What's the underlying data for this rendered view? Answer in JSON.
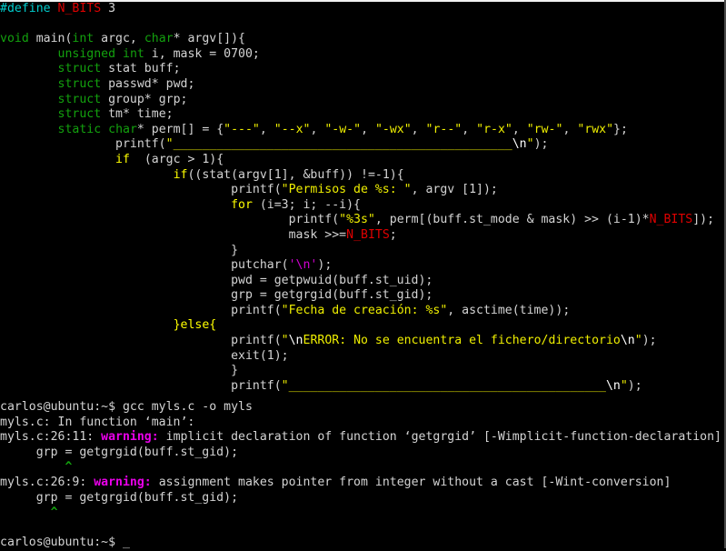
{
  "window": {
    "title": "myls.c — gcc compile session",
    "background_color": "#000000",
    "top_edge_color": "#f2f2f2",
    "right_edge_color": "#4a4a4a"
  },
  "palette": {
    "plain": "#d4d4d4",
    "keyword": "#13a10e",
    "preprocessor": "#00cdcd",
    "macro": "#e00000",
    "string": "#eeee00",
    "control": "#ffff00",
    "char_literal": "#d000d0",
    "escape": "#ffffff",
    "warning": "#ea00ea",
    "caret": "#13a10e"
  },
  "editor": {
    "language": "c",
    "filename": "myls.c",
    "lines": [
      [
        {
          "t": "#define ",
          "c": "c-preproc"
        },
        {
          "t": "N_BITS",
          "c": "c-macro"
        },
        {
          "t": " 3",
          "c": "c-plain"
        }
      ],
      [],
      [
        {
          "t": "void",
          "c": "c-keyword"
        },
        {
          "t": " main(",
          "c": "c-plain"
        },
        {
          "t": "int",
          "c": "c-keyword"
        },
        {
          "t": " argc, ",
          "c": "c-plain"
        },
        {
          "t": "char",
          "c": "c-keyword"
        },
        {
          "t": "* argv[]){",
          "c": "c-plain"
        }
      ],
      [
        {
          "t": "        ",
          "c": "c-plain"
        },
        {
          "t": "unsigned",
          "c": "c-keyword"
        },
        {
          "t": " ",
          "c": "c-plain"
        },
        {
          "t": "int",
          "c": "c-keyword"
        },
        {
          "t": " i, mask = 0700;",
          "c": "c-plain"
        }
      ],
      [
        {
          "t": "        ",
          "c": "c-plain"
        },
        {
          "t": "struct",
          "c": "c-keyword"
        },
        {
          "t": " stat buff;",
          "c": "c-plain"
        }
      ],
      [
        {
          "t": "        ",
          "c": "c-plain"
        },
        {
          "t": "struct",
          "c": "c-keyword"
        },
        {
          "t": " passwd* pwd;",
          "c": "c-plain"
        }
      ],
      [
        {
          "t": "        ",
          "c": "c-plain"
        },
        {
          "t": "struct",
          "c": "c-keyword"
        },
        {
          "t": " group* grp;",
          "c": "c-plain"
        }
      ],
      [
        {
          "t": "        ",
          "c": "c-plain"
        },
        {
          "t": "struct",
          "c": "c-keyword"
        },
        {
          "t": " tm* time;",
          "c": "c-plain"
        }
      ],
      [
        {
          "t": "        ",
          "c": "c-plain"
        },
        {
          "t": "static",
          "c": "c-keyword"
        },
        {
          "t": " ",
          "c": "c-plain"
        },
        {
          "t": "char",
          "c": "c-keyword"
        },
        {
          "t": "* perm[] = {",
          "c": "c-plain"
        },
        {
          "t": "\"---\"",
          "c": "c-string"
        },
        {
          "t": ", ",
          "c": "c-plain"
        },
        {
          "t": "\"--x\"",
          "c": "c-string"
        },
        {
          "t": ", ",
          "c": "c-plain"
        },
        {
          "t": "\"-w-\"",
          "c": "c-string"
        },
        {
          "t": ", ",
          "c": "c-plain"
        },
        {
          "t": "\"-wx\"",
          "c": "c-string"
        },
        {
          "t": ", ",
          "c": "c-plain"
        },
        {
          "t": "\"r--\"",
          "c": "c-string"
        },
        {
          "t": ", ",
          "c": "c-plain"
        },
        {
          "t": "\"r-x\"",
          "c": "c-string"
        },
        {
          "t": ", ",
          "c": "c-plain"
        },
        {
          "t": "\"rw-\"",
          "c": "c-string"
        },
        {
          "t": ", ",
          "c": "c-plain"
        },
        {
          "t": "\"rwx\"",
          "c": "c-string"
        },
        {
          "t": "};",
          "c": "c-plain"
        }
      ],
      [
        {
          "t": "                ",
          "c": "c-plain"
        },
        {
          "t": "printf(",
          "c": "c-plain"
        },
        {
          "t": "\"_______________________________________________",
          "c": "c-string"
        },
        {
          "t": "\\n",
          "c": "c-esc"
        },
        {
          "t": "\"",
          "c": "c-string"
        },
        {
          "t": ");",
          "c": "c-plain"
        }
      ],
      [
        {
          "t": "                ",
          "c": "c-plain"
        },
        {
          "t": "if",
          "c": "c-control"
        },
        {
          "t": "  (argc > 1){",
          "c": "c-plain"
        }
      ],
      [
        {
          "t": "                        ",
          "c": "c-plain"
        },
        {
          "t": "if",
          "c": "c-control"
        },
        {
          "t": "((stat(argv[1], &buff)) !=-1){",
          "c": "c-plain"
        }
      ],
      [
        {
          "t": "                                ",
          "c": "c-plain"
        },
        {
          "t": "printf(",
          "c": "c-plain"
        },
        {
          "t": "\"Permisos de %s: \"",
          "c": "c-string"
        },
        {
          "t": ", argv [1]);",
          "c": "c-plain"
        }
      ],
      [
        {
          "t": "                                ",
          "c": "c-plain"
        },
        {
          "t": "for",
          "c": "c-control"
        },
        {
          "t": " (i=3; i; --i){",
          "c": "c-plain"
        }
      ],
      [
        {
          "t": "                                        ",
          "c": "c-plain"
        },
        {
          "t": "printf(",
          "c": "c-plain"
        },
        {
          "t": "\"%3s\"",
          "c": "c-string"
        },
        {
          "t": ", perm[(buff.st_mode & mask) >> (i-1)*",
          "c": "c-plain"
        },
        {
          "t": "N_BITS",
          "c": "c-macro"
        },
        {
          "t": "]);",
          "c": "c-plain"
        }
      ],
      [
        {
          "t": "                                        ",
          "c": "c-plain"
        },
        {
          "t": "mask >>=",
          "c": "c-plain"
        },
        {
          "t": "N_BITS",
          "c": "c-macro"
        },
        {
          "t": ";",
          "c": "c-plain"
        }
      ],
      [
        {
          "t": "                                }",
          "c": "c-plain"
        }
      ],
      [
        {
          "t": "                                ",
          "c": "c-plain"
        },
        {
          "t": "putchar(",
          "c": "c-plain"
        },
        {
          "t": "'\\n'",
          "c": "c-char"
        },
        {
          "t": ");",
          "c": "c-plain"
        }
      ],
      [
        {
          "t": "                                pwd = getpwuid(buff.st_uid);",
          "c": "c-plain"
        }
      ],
      [
        {
          "t": "                                grp = getgrgid(buff.st_gid);",
          "c": "c-plain"
        }
      ],
      [
        {
          "t": "                                ",
          "c": "c-plain"
        },
        {
          "t": "printf(",
          "c": "c-plain"
        },
        {
          "t": "\"Fecha de creación: %s\"",
          "c": "c-string"
        },
        {
          "t": ", asctime(time));",
          "c": "c-plain"
        }
      ],
      [
        {
          "t": "                        ",
          "c": "c-plain"
        },
        {
          "t": "}else{",
          "c": "c-control"
        }
      ],
      [
        {
          "t": "                                ",
          "c": "c-plain"
        },
        {
          "t": "printf(",
          "c": "c-plain"
        },
        {
          "t": "\"",
          "c": "c-string"
        },
        {
          "t": "\\n",
          "c": "c-esc"
        },
        {
          "t": "ERROR: No se encuentra el fichero/directorio",
          "c": "c-string"
        },
        {
          "t": "\\n",
          "c": "c-esc"
        },
        {
          "t": "\"",
          "c": "c-string"
        },
        {
          "t": ");",
          "c": "c-plain"
        }
      ],
      [
        {
          "t": "                                exit(1);",
          "c": "c-plain"
        }
      ],
      [
        {
          "t": "                                }",
          "c": "c-plain"
        }
      ],
      [
        {
          "t": "                                ",
          "c": "c-plain"
        },
        {
          "t": "printf(",
          "c": "c-plain"
        },
        {
          "t": "\"____________________________________________",
          "c": "c-string"
        },
        {
          "t": "\\n",
          "c": "c-esc"
        },
        {
          "t": "\"",
          "c": "c-string"
        },
        {
          "t": ");",
          "c": "c-plain"
        }
      ]
    ]
  },
  "terminal": {
    "prompt": "carlos@ubuntu:~$",
    "cursor": "_",
    "lines": [
      [
        {
          "t": "carlos@ubuntu:~$ gcc myls.c -o myls",
          "c": "t-plain"
        }
      ],
      [
        {
          "t": "myls.c: In function ‘main’:",
          "c": "t-plain"
        }
      ],
      [
        {
          "t": "myls.c:26:11: ",
          "c": "t-plain"
        },
        {
          "t": "warning:",
          "c": "t-warn"
        },
        {
          "t": " implicit declaration of function ‘getgrgid’ [-Wimplicit-function-declaration]",
          "c": "t-plain"
        }
      ],
      [
        {
          "t": "     grp = getgrgid(buff.st_gid);",
          "c": "t-plain"
        }
      ],
      [
        {
          "t": "         ",
          "c": "t-plain"
        },
        {
          "t": "^",
          "c": "t-caret"
        }
      ],
      [
        {
          "t": "myls.c:26:9: ",
          "c": "t-plain"
        },
        {
          "t": "warning:",
          "c": "t-warn"
        },
        {
          "t": " assignment makes pointer from integer without a cast [-Wint-conversion]",
          "c": "t-plain"
        }
      ],
      [
        {
          "t": "     grp = getgrgid(buff.st_gid);",
          "c": "t-plain"
        }
      ],
      [
        {
          "t": "       ",
          "c": "t-plain"
        },
        {
          "t": "^",
          "c": "t-caret"
        }
      ],
      [],
      [
        {
          "t": "carlos@ubuntu:~$ ",
          "c": "t-plain"
        },
        {
          "t": "_",
          "c": "t-cursor"
        }
      ]
    ]
  }
}
